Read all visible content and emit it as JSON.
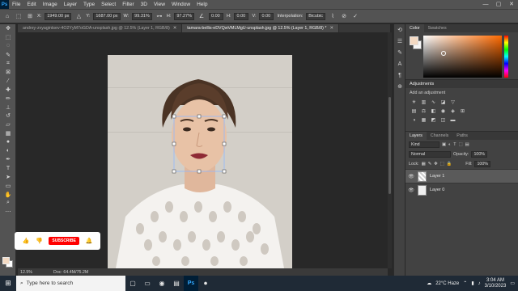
{
  "menu": {
    "logo": "Ps",
    "items": [
      "File",
      "Edit",
      "Image",
      "Layer",
      "Type",
      "Select",
      "Filter",
      "3D",
      "View",
      "Window",
      "Help"
    ],
    "window_controls": [
      "—",
      "▢",
      "✕"
    ]
  },
  "options": {
    "x_label": "X:",
    "x_value": "1949.00 px",
    "y_label": "Y:",
    "y_value": "1687.00 px",
    "w_label": "W:",
    "w_value": "99.31%",
    "h_label": "H:",
    "h_value": "97.27%",
    "angle_value": "0.00",
    "h_skew_label": "H:",
    "h_skew_value": "0.00",
    "v_skew_label": "V:",
    "v_skew_value": "0.00",
    "interp_label": "Interpolation:",
    "interp_value": "Bicubic"
  },
  "tabs": [
    {
      "label": "andrey-zvyagintsev-4O2YyM7oGDA-unsplash.jpg @ 12.5% (Layer 1, RGB/8)",
      "active": false
    },
    {
      "label": "tamara-bellis-eDVQwVMLMgU-unsplash.jpg @ 12.5% (Layer 1, RGB/8) *",
      "active": true
    }
  ],
  "status": {
    "zoom": "12.5%",
    "doc": "Doc: 64.4M/75.2M"
  },
  "panel": {
    "color_tabs": [
      "Color",
      "Swatches"
    ],
    "adjustments_title": "Adjustments",
    "add_adjustment": "Add an adjustment",
    "layers_tabs": [
      "Layers",
      "Channels",
      "Paths"
    ],
    "kind": "Kind",
    "blend_mode": "Normal",
    "opacity_label": "Opacity:",
    "opacity_value": "100%",
    "lock_label": "Lock:",
    "fill_label": "Fill:",
    "fill_value": "100%",
    "layers": [
      {
        "name": "Layer 1",
        "selected": true
      },
      {
        "name": "Layer 0",
        "selected": false
      }
    ]
  },
  "subscribe": {
    "label": "SUBSCRIBE"
  },
  "taskbar": {
    "search_placeholder": "Type here to search",
    "weather": "22°C  Haze",
    "time": "3:04 AM",
    "date": "3/10/2023"
  }
}
